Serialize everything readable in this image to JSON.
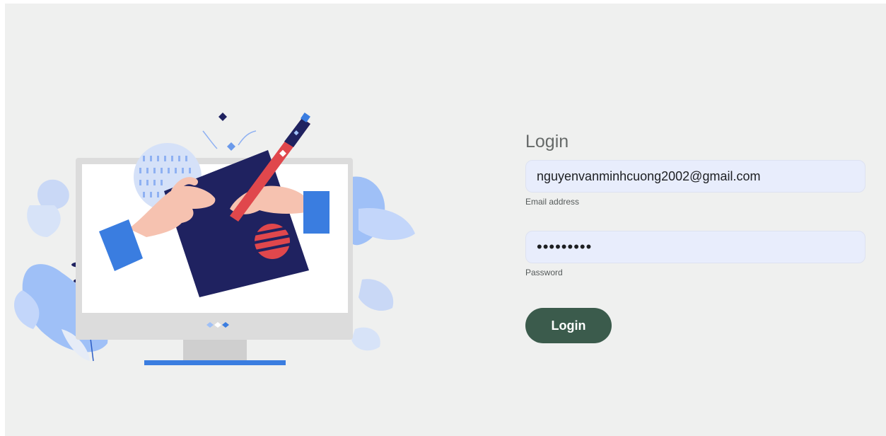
{
  "login_form": {
    "title": "Login",
    "email": {
      "value": "nguyenvanminhcuong2002@gmail.com",
      "label": "Email address"
    },
    "password": {
      "value": "•••••••••",
      "label": "Password"
    },
    "submit_label": "Login"
  },
  "illustration": {
    "icon": "computer-drawing-illustration"
  },
  "colors": {
    "background": "#eff0ef",
    "input_background": "#e8edfc",
    "button": "#3b5b4c",
    "illustration_navy": "#1f2260",
    "illustration_blue": "#3a7de0",
    "illustration_red": "#e0474c"
  }
}
